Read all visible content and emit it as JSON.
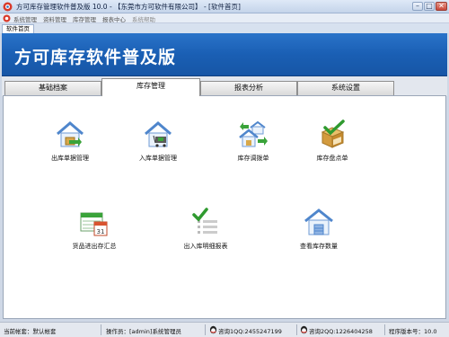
{
  "window": {
    "title": "方可库存管理软件普及版 10.0 - 【东莞市方可软件有限公司】 - [软件首页]"
  },
  "menu": {
    "items": [
      {
        "label": "系统管理"
      },
      {
        "label": "资料管理"
      },
      {
        "label": "库存管理"
      },
      {
        "label": "报表中心"
      },
      {
        "label": "系统帮助"
      }
    ]
  },
  "doc_tab": {
    "label": "软件首页"
  },
  "banner": {
    "title": "方可库存软件普及版"
  },
  "module_tabs": [
    {
      "label": "基础档案",
      "active": false
    },
    {
      "label": "库存管理",
      "active": true
    },
    {
      "label": "报表分析",
      "active": false
    },
    {
      "label": "系统设置",
      "active": false
    }
  ],
  "functions": [
    {
      "label": "出库单据管理",
      "icon": "outbound-house-icon"
    },
    {
      "label": "入库单据管理",
      "icon": "inbound-house-cart-icon"
    },
    {
      "label": "库存调拨单",
      "icon": "transfer-houses-icon"
    },
    {
      "label": "库存盘点单",
      "icon": "inventory-check-box-icon"
    },
    {
      "label": "货品进出存汇总",
      "icon": "calendar-summary-icon"
    },
    {
      "label": "出入库明细报表",
      "icon": "detail-report-check-icon"
    },
    {
      "label": "查看库存数量",
      "icon": "warehouse-view-icon"
    }
  ],
  "status": {
    "current_account": "当前帐套：默认帐套",
    "operator": "操作员：[admin]系统管理员",
    "qq1": "咨询1QQ:2455247199",
    "qq2": "咨询2QQ:1226404258",
    "version": "程序版本号：10.0"
  },
  "colors": {
    "banner": "#1a5fb4",
    "accent_green": "#3aa33a",
    "house_blue": "#5b8fd0"
  }
}
